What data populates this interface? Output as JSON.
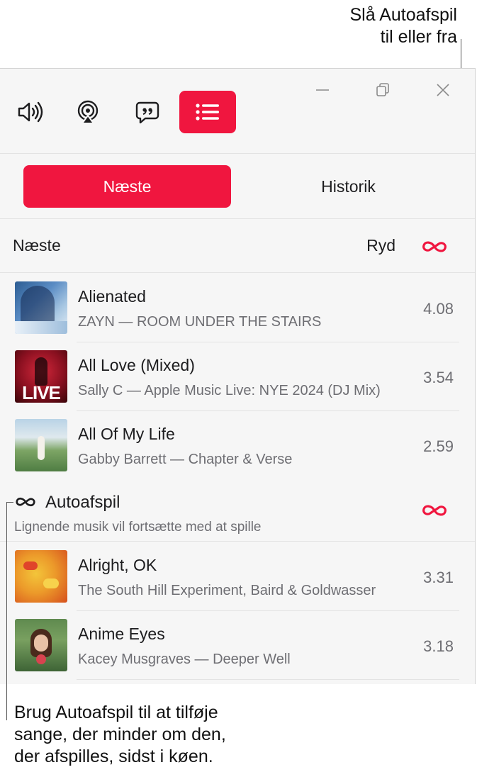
{
  "callouts": {
    "top_line1": "Slå Autoafspil",
    "top_line2": "til eller fra",
    "bottom_line1": "Brug Autoafspil til at tilføje",
    "bottom_line2": "sange, der minder om den,",
    "bottom_line3": "der afspilles, sidst i køen."
  },
  "toolbar": {
    "buttons": [
      {
        "name": "volume",
        "icon": "speaker-wave-icon"
      },
      {
        "name": "airplay",
        "icon": "airplay-icon"
      },
      {
        "name": "lyrics",
        "icon": "lyrics-quote-icon"
      },
      {
        "name": "queue",
        "icon": "list-icon",
        "active": true
      }
    ],
    "window_controls": [
      "minimize-icon",
      "restore-icon",
      "close-icon"
    ]
  },
  "tabs": {
    "next": "Næste",
    "history": "Historik"
  },
  "queue": {
    "heading": "Næste",
    "clear": "Ryd",
    "tracks": [
      {
        "title": "Alienated",
        "subtitle": "ZAYN — ROOM UNDER THE STAIRS",
        "duration": "4.08"
      },
      {
        "title": "All Love (Mixed)",
        "subtitle": "Sally C — Apple Music Live: NYE 2024 (DJ Mix)",
        "duration": "3.54",
        "art_text": "LIVE"
      },
      {
        "title": "All Of My Life",
        "subtitle": "Gabby Barrett — Chapter & Verse",
        "duration": "2.59"
      }
    ]
  },
  "autoplay": {
    "title": "Autoafspil",
    "subtitle": "Lignende musik vil fortsætte med at spille",
    "tracks": [
      {
        "title": "Alright, OK",
        "subtitle": "The South Hill Experiment, Baird & Goldwasser",
        "duration": "3.31"
      },
      {
        "title": "Anime Eyes",
        "subtitle": "Kacey Musgraves — Deeper Well",
        "duration": "3.18"
      }
    ]
  },
  "colors": {
    "accent": "#f0163f",
    "panel_bg": "#f6f6f6",
    "secondary_text": "#6e6e73"
  }
}
